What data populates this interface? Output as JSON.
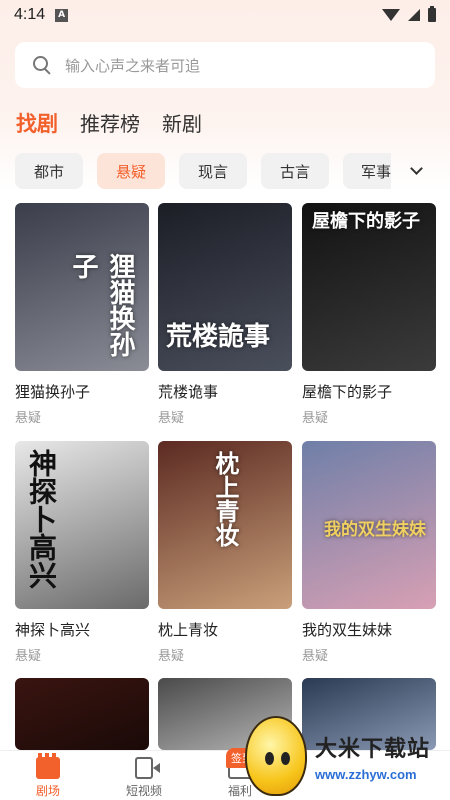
{
  "status_bar": {
    "time": "4:14",
    "notification_icon": "a-icon"
  },
  "search": {
    "placeholder": "输入心声之来者可追"
  },
  "tabs": [
    {
      "label": "找剧",
      "active": true
    },
    {
      "label": "推荐榜",
      "active": false
    },
    {
      "label": "新剧",
      "active": false
    }
  ],
  "genres": [
    {
      "label": "都市",
      "active": false
    },
    {
      "label": "悬疑",
      "active": true
    },
    {
      "label": "现言",
      "active": false
    },
    {
      "label": "古言",
      "active": false
    },
    {
      "label": "军事",
      "active": false
    }
  ],
  "dramas": [
    {
      "title": "狸猫换孙子",
      "genre": "悬疑",
      "poster_text": "狸猫换孙子",
      "colors": [
        "#3a3d4a",
        "#8a8d96"
      ]
    },
    {
      "title": "荒楼诡事",
      "genre": "悬疑",
      "poster_text": "荒楼詭事",
      "colors": [
        "#1c1e26",
        "#4a4f5c"
      ]
    },
    {
      "title": "屋檐下的影子",
      "genre": "悬疑",
      "poster_text": "屋檐下的影子",
      "colors": [
        "#121212",
        "#3b3b3b"
      ]
    },
    {
      "title": "神探卜高兴",
      "genre": "悬疑",
      "poster_text": "神探卜高兴",
      "colors": [
        "#e8e8e8",
        "#6a6a6a"
      ]
    },
    {
      "title": "枕上青妆",
      "genre": "悬疑",
      "poster_text": "枕上青妆",
      "colors": [
        "#5c2a22",
        "#c9a07a"
      ]
    },
    {
      "title": "我的双生妹妹",
      "genre": "悬疑",
      "poster_text": "我的双生妹妹",
      "colors": [
        "#6f7fa8",
        "#d8a0b4"
      ]
    },
    {
      "title": "",
      "genre": "",
      "poster_text": "",
      "colors": [
        "#3a1410",
        "#1a0a08"
      ]
    },
    {
      "title": "",
      "genre": "",
      "poster_text": "",
      "colors": [
        "#4a4a4a",
        "#b5b5b5"
      ]
    },
    {
      "title": "",
      "genre": "",
      "poster_text": "",
      "colors": [
        "#2a3a52",
        "#8a9ab5"
      ]
    }
  ],
  "bottom_nav": [
    {
      "label": "剧场",
      "icon": "theater-icon",
      "active": true
    },
    {
      "label": "短视频",
      "icon": "video-icon",
      "active": false
    },
    {
      "label": "福利",
      "icon": "gift-icon",
      "active": false,
      "badge": "签到"
    }
  ],
  "watermark": {
    "name": "大米下载站",
    "url": "www.zzhyw.com"
  },
  "colors": {
    "accent": "#f2602c",
    "chip_bg": "#f1f1f1",
    "chip_active_bg": "#fde4d9"
  }
}
